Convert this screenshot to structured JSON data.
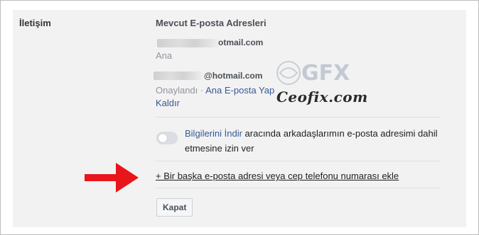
{
  "section": {
    "label": "İletişim"
  },
  "emails": {
    "heading": "Mevcut E-posta Adresleri",
    "primary": {
      "address_visible": "otmail.com",
      "status": "Ana"
    },
    "secondary": {
      "address_visible": "@hotmail.com",
      "status": "Onaylandı",
      "separator": "·",
      "make_primary_label": "Ana E-posta Yap",
      "remove_label": "Kaldır"
    }
  },
  "download_info": {
    "link_label": "Bilgilerini İndir",
    "rest_text": " aracında arkadaşlarımın e-posta adresimi dahil etmesine izin ver",
    "toggle_state": "off"
  },
  "add_contact": {
    "label": "+ Bir başka e-posta adresi veya cep telefonu numarası ekle"
  },
  "actions": {
    "close_label": "Kapat"
  },
  "watermark": {
    "logo": "GFX",
    "text": "Ceofix.com"
  },
  "colors": {
    "link": "#365899",
    "arrow": "#e8151b",
    "panel_bg": "#f2f2f2",
    "muted_text": "#90949c"
  }
}
